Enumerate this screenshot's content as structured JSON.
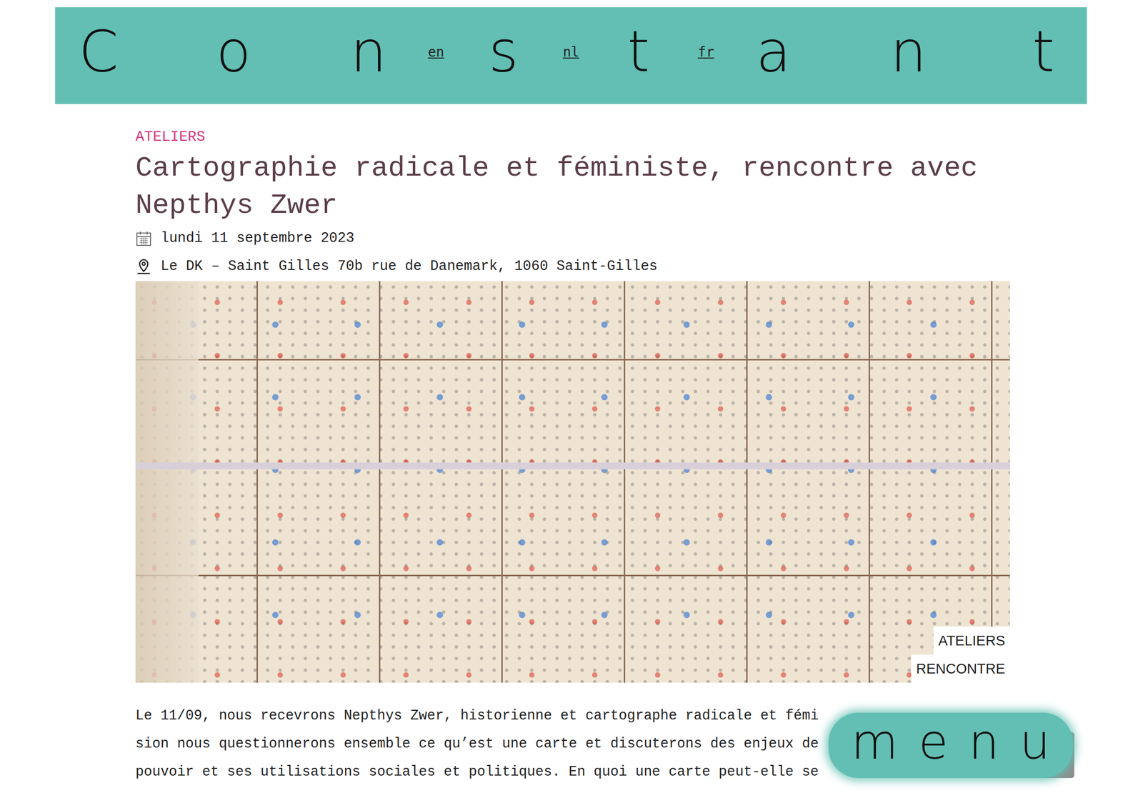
{
  "header": {
    "letters": [
      "C",
      "o",
      "n",
      "s",
      "t",
      "a",
      "n",
      "t"
    ],
    "languages": [
      "en",
      "nl",
      "fr"
    ]
  },
  "article": {
    "category": "ATELIERS",
    "title": "Cartographie radicale et féministe, rencontre avec Nepthys Zwer",
    "date": "lundi 11 septembre 2023",
    "location": "Le DK – Saint Gilles 70b rue de Danemark, 1060 Saint-Gilles",
    "tags": [
      "ATELIERS",
      "RENCONTRE"
    ],
    "body": [
      "Le 11/09, nous recevrons Nepthys Zwer, historienne et cartographe radicale et fémi",
      "sion nous questionnerons ensemble ce qu’est une carte et discuterons des enjeux de",
      "pouvoir et ses utilisations sociales et politiques. En quoi une carte peut-elle se"
    ]
  },
  "menu": {
    "label": "menu"
  }
}
